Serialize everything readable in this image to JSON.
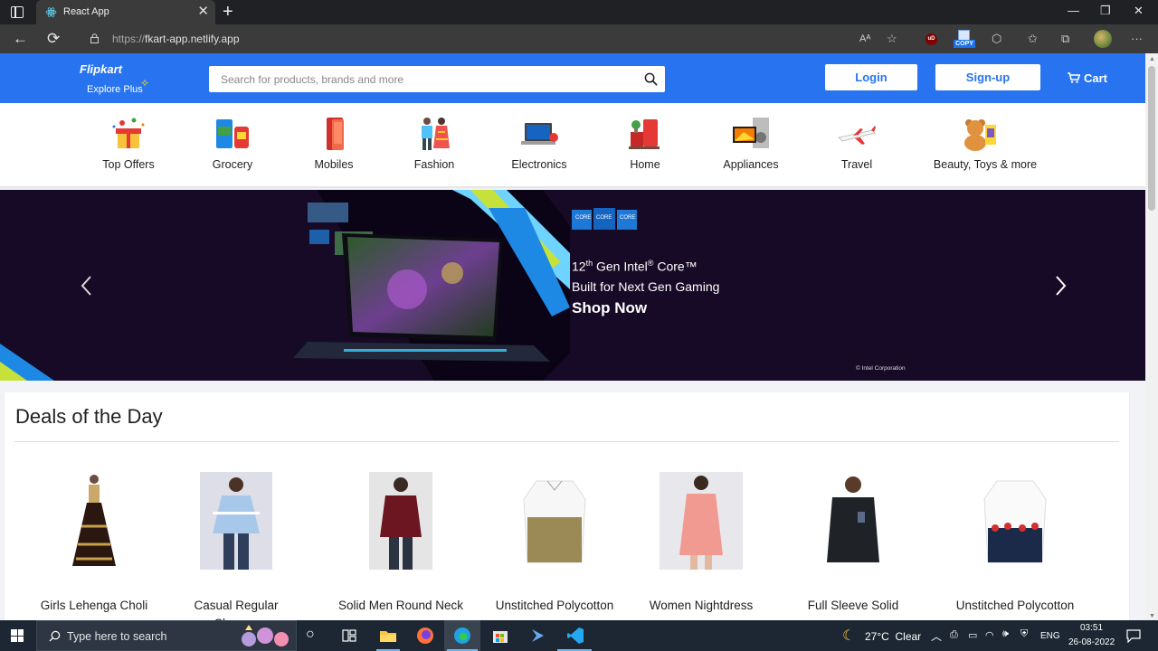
{
  "browser": {
    "tab_title": "React App",
    "url_scheme": "https://",
    "url_host": "fkart-app.netlify.app",
    "copy_extension_label": "COPY",
    "ud_extension_label": "uD"
  },
  "header": {
    "logo_title": "Flipkart",
    "logo_subtitle": "Explore Plus",
    "search_placeholder": "Search for products, brands and more",
    "login_label": "Login",
    "signup_label": "Sign-up",
    "cart_label": "Cart"
  },
  "categories": [
    {
      "label": "Top Offers",
      "icon": "gift-icon"
    },
    {
      "label": "Grocery",
      "icon": "grocery-icon"
    },
    {
      "label": "Mobiles",
      "icon": "mobile-phone-icon"
    },
    {
      "label": "Fashion",
      "icon": "fashion-icon"
    },
    {
      "label": "Electronics",
      "icon": "laptop-icon"
    },
    {
      "label": "Home",
      "icon": "home-furniture-icon"
    },
    {
      "label": "Appliances",
      "icon": "appliances-icon"
    },
    {
      "label": "Travel",
      "icon": "airplane-icon"
    },
    {
      "label": "Beauty, Toys & more",
      "icon": "teddy-bear-icon"
    }
  ],
  "banner": {
    "line1_prefix": "12",
    "line1_sup1": "th",
    "line1_middle": " Gen Intel",
    "line1_sup2": "®",
    "line1_suffix": " Core™",
    "line2": "Built for Next Gen Gaming",
    "cta": "Shop Now",
    "corp": "© Intel Corporation",
    "badge_text": "CORE"
  },
  "deals": {
    "title": "Deals of the Day",
    "products": [
      {
        "name": "Girls Lehenga Choli"
      },
      {
        "name": "Casual Regular Sleeves"
      },
      {
        "name": "Solid Men Round Neck"
      },
      {
        "name": "Unstitched Polycotton"
      },
      {
        "name": "Women Nightdress"
      },
      {
        "name": "Full Sleeve Solid"
      },
      {
        "name": "Unstitched Polycotton"
      }
    ]
  },
  "taskbar": {
    "search_placeholder": "Type here to search",
    "weather": "27°C  Clear",
    "language": "ENG",
    "time": "03:51",
    "date": "26-08-2022"
  },
  "colors": {
    "brand_blue": "#2874f0",
    "brand_yellow": "#ffe11b",
    "banner_bg": "#170a26",
    "taskbar_bg": "#1d2733"
  }
}
